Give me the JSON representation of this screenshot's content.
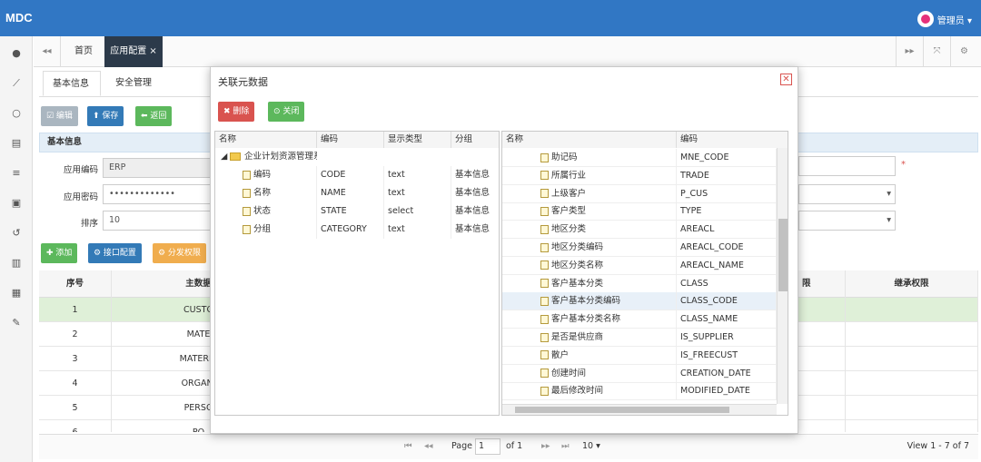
{
  "app": {
    "logo": "MDC",
    "user": "管理员 ▾"
  },
  "sidebar": {
    "icons": [
      "palette-icon",
      "chart-icon",
      "cog-outline-icon",
      "database-icon",
      "list-icon",
      "form-icon",
      "history-icon",
      "archive-icon",
      "server-icon",
      "wrench-icon"
    ],
    "glyphs": [
      "●",
      "⟋",
      "○",
      "▤",
      "≡",
      "▣",
      "↺",
      "▥",
      "▦",
      "✎"
    ]
  },
  "tabs": {
    "back": "◂◂",
    "home": "首页",
    "active": "应用配置 ×",
    "forward": "▸▸",
    "expand": "⤧",
    "settings": "⚙"
  },
  "subtabs": {
    "basic": "基本信息",
    "security": "安全管理"
  },
  "toolbar": {
    "edit": "☑ 编辑",
    "save": "⬆ 保存",
    "back": "⬅ 返回"
  },
  "panel": {
    "title": "基本信息"
  },
  "form": {
    "code_label": "应用编码",
    "code_value": "ERP",
    "pwd_label": "应用密码",
    "pwd_value": "•••••••••••••",
    "sort_label": "排序",
    "sort_value": "10",
    "required_mark": "*"
  },
  "actions": {
    "add": "✚ 添加",
    "iface": "⚙ 接口配置",
    "dist": "⚙ 分发权限"
  },
  "grid": {
    "headers": [
      "序号",
      "主数据",
      "",
      "继承权限"
    ],
    "trailing_header": "限",
    "rows": [
      {
        "no": "1",
        "name": "CUSTO"
      },
      {
        "no": "2",
        "name": "MATE"
      },
      {
        "no": "3",
        "name": "MATERIA"
      },
      {
        "no": "4",
        "name": "ORGANI"
      },
      {
        "no": "5",
        "name": "PERSO"
      },
      {
        "no": "6",
        "name": "PO"
      }
    ]
  },
  "pager": {
    "first": "⏮",
    "prev": "◂◂",
    "page_label": "Page",
    "page": "1",
    "of": "of 1",
    "next": "▸▸",
    "last": "⏭",
    "size": "10 ▾",
    "view": "View 1 - 7 of 7"
  },
  "modal": {
    "title": "关联元数据",
    "delete": "✖ 删除",
    "close": "⊙ 关闭",
    "left_headers": [
      "名称",
      "编码",
      "显示类型",
      "分组"
    ],
    "root": "企业计划资源管理系",
    "left_rows": [
      {
        "name": "编码",
        "code": "CODE",
        "type": "text",
        "group": "基本信息"
      },
      {
        "name": "名称",
        "code": "NAME",
        "type": "text",
        "group": "基本信息"
      },
      {
        "name": "状态",
        "code": "STATE",
        "type": "select",
        "group": "基本信息"
      },
      {
        "name": "分组",
        "code": "CATEGORY",
        "type": "text",
        "group": "基本信息"
      }
    ],
    "right_headers": [
      "名称",
      "编码"
    ],
    "right_rows": [
      {
        "name": "助记码",
        "code": "MNE_CODE"
      },
      {
        "name": "所属行业",
        "code": "TRADE"
      },
      {
        "name": "上级客户",
        "code": "P_CUS"
      },
      {
        "name": "客户类型",
        "code": "TYPE"
      },
      {
        "name": "地区分类",
        "code": "AREACL"
      },
      {
        "name": "地区分类编码",
        "code": "AREACL_CODE"
      },
      {
        "name": "地区分类名称",
        "code": "AREACL_NAME"
      },
      {
        "name": "客户基本分类",
        "code": "CLASS"
      },
      {
        "name": "客户基本分类编码",
        "code": "CLASS_CODE"
      },
      {
        "name": "客户基本分类名称",
        "code": "CLASS_NAME"
      },
      {
        "name": "是否是供应商",
        "code": "IS_SUPPLIER"
      },
      {
        "name": "散户",
        "code": "IS_FREECUST"
      },
      {
        "name": "创建时间",
        "code": "CREATION_DATE"
      },
      {
        "name": "最后修改时间",
        "code": "MODIFIED_DATE"
      }
    ]
  }
}
